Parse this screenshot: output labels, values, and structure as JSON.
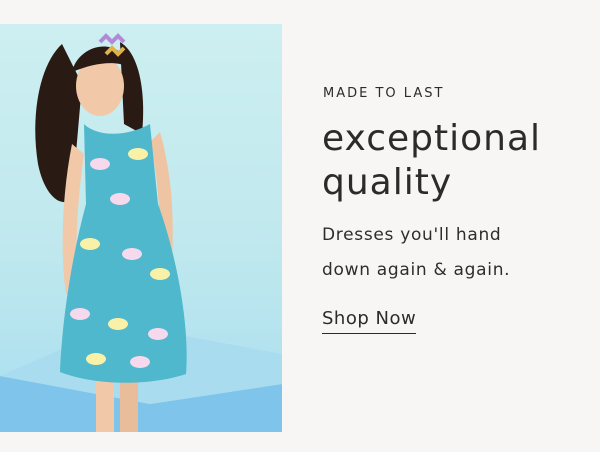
{
  "promo": {
    "eyebrow": "MADE TO LAST",
    "headline_line1": "exceptional",
    "headline_line2": "quality",
    "subtext_line1": "Dresses you'll hand",
    "subtext_line2": "down again & again.",
    "cta_label": "Shop Now"
  },
  "image": {
    "subject": "girl-in-fish-print-dress",
    "background_color": "#c6ecf0",
    "dress_color": "#4fb8cc"
  },
  "colors": {
    "page_background": "#f7f6f4",
    "text": "#2b2b2b"
  }
}
